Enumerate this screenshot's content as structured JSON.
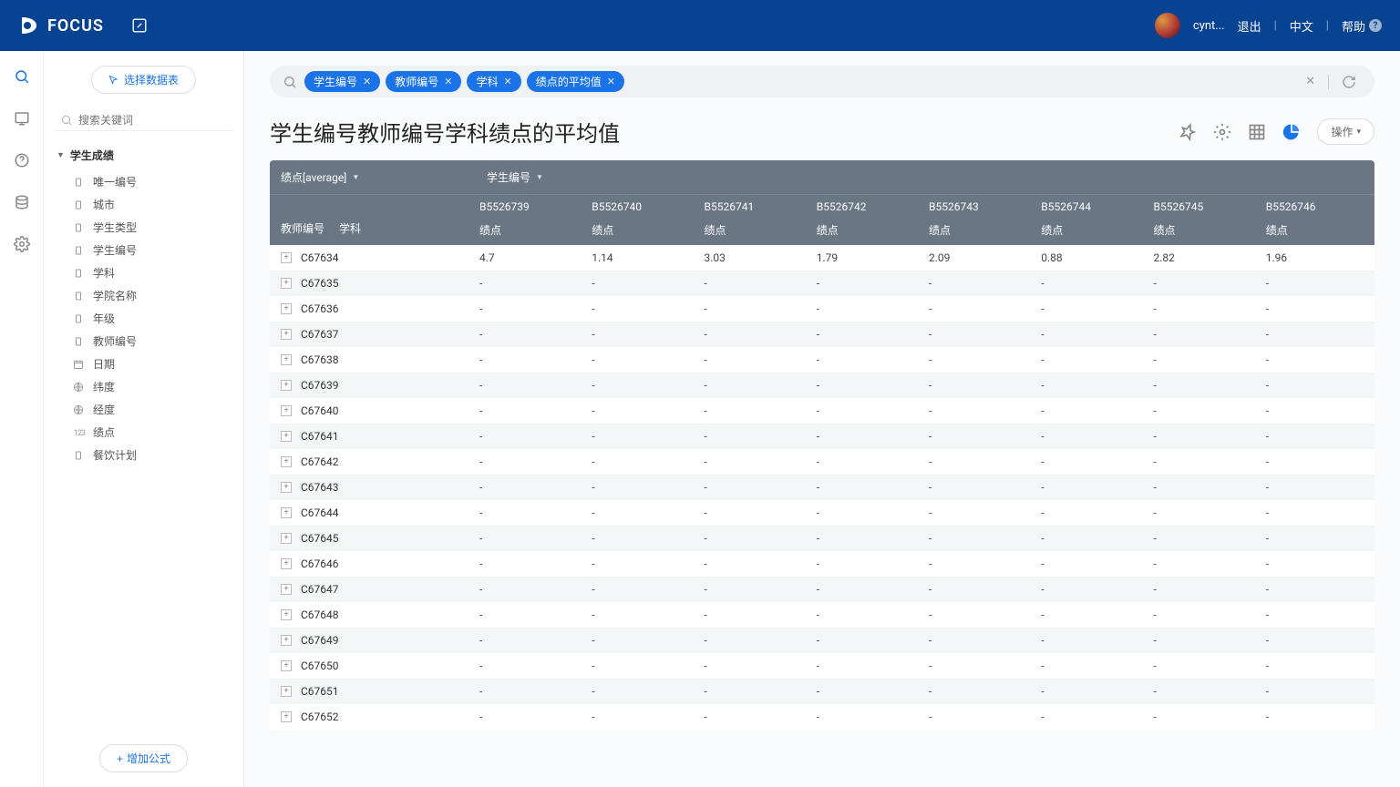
{
  "header": {
    "app_name": "FOCUS",
    "user_name": "cynt...",
    "logout": "退出",
    "lang": "中文",
    "help": "帮助"
  },
  "sidebar": {
    "select_table": "选择数据表",
    "search_placeholder": "搜索关键词",
    "tree_label": "学生成绩",
    "items": [
      {
        "icon": "T",
        "label": "唯一编号"
      },
      {
        "icon": "T",
        "label": "城市"
      },
      {
        "icon": "T",
        "label": "学生类型"
      },
      {
        "icon": "T",
        "label": "学生编号"
      },
      {
        "icon": "T",
        "label": "学科"
      },
      {
        "icon": "T",
        "label": "学院名称"
      },
      {
        "icon": "T",
        "label": "年级"
      },
      {
        "icon": "T",
        "label": "教师编号"
      },
      {
        "icon": "cal",
        "label": "日期"
      },
      {
        "icon": "geo",
        "label": "纬度"
      },
      {
        "icon": "geo",
        "label": "经度"
      },
      {
        "icon": "123",
        "label": "绩点"
      },
      {
        "icon": "T",
        "label": "餐饮计划"
      }
    ],
    "add_formula": "增加公式"
  },
  "query": {
    "chips": [
      "学生编号",
      "教师编号",
      "学科",
      "绩点的平均值"
    ]
  },
  "content": {
    "title": "学生编号教师编号学科绩点的平均值",
    "op_label": "操作",
    "thead_metric": "绩点[average]",
    "thead_dim": "学生编号",
    "row_label_a": "教师编号",
    "row_label_b": "学科",
    "sub_metric": "绩点",
    "columns": [
      "B5526739",
      "B5526740",
      "B5526741",
      "B5526742",
      "B5526743",
      "B5526744",
      "B5526745",
      "B5526746"
    ],
    "rows": [
      {
        "id": "C67634",
        "vals": [
          "4.7",
          "1.14",
          "3.03",
          "1.79",
          "2.09",
          "0.88",
          "2.82",
          "1.96"
        ]
      },
      {
        "id": "C67635",
        "vals": [
          "-",
          "-",
          "-",
          "-",
          "-",
          "-",
          "-",
          "-"
        ]
      },
      {
        "id": "C67636",
        "vals": [
          "-",
          "-",
          "-",
          "-",
          "-",
          "-",
          "-",
          "-"
        ]
      },
      {
        "id": "C67637",
        "vals": [
          "-",
          "-",
          "-",
          "-",
          "-",
          "-",
          "-",
          "-"
        ]
      },
      {
        "id": "C67638",
        "vals": [
          "-",
          "-",
          "-",
          "-",
          "-",
          "-",
          "-",
          "-"
        ]
      },
      {
        "id": "C67639",
        "vals": [
          "-",
          "-",
          "-",
          "-",
          "-",
          "-",
          "-",
          "-"
        ]
      },
      {
        "id": "C67640",
        "vals": [
          "-",
          "-",
          "-",
          "-",
          "-",
          "-",
          "-",
          "-"
        ]
      },
      {
        "id": "C67641",
        "vals": [
          "-",
          "-",
          "-",
          "-",
          "-",
          "-",
          "-",
          "-"
        ]
      },
      {
        "id": "C67642",
        "vals": [
          "-",
          "-",
          "-",
          "-",
          "-",
          "-",
          "-",
          "-"
        ]
      },
      {
        "id": "C67643",
        "vals": [
          "-",
          "-",
          "-",
          "-",
          "-",
          "-",
          "-",
          "-"
        ]
      },
      {
        "id": "C67644",
        "vals": [
          "-",
          "-",
          "-",
          "-",
          "-",
          "-",
          "-",
          "-"
        ]
      },
      {
        "id": "C67645",
        "vals": [
          "-",
          "-",
          "-",
          "-",
          "-",
          "-",
          "-",
          "-"
        ]
      },
      {
        "id": "C67646",
        "vals": [
          "-",
          "-",
          "-",
          "-",
          "-",
          "-",
          "-",
          "-"
        ]
      },
      {
        "id": "C67647",
        "vals": [
          "-",
          "-",
          "-",
          "-",
          "-",
          "-",
          "-",
          "-"
        ]
      },
      {
        "id": "C67648",
        "vals": [
          "-",
          "-",
          "-",
          "-",
          "-",
          "-",
          "-",
          "-"
        ]
      },
      {
        "id": "C67649",
        "vals": [
          "-",
          "-",
          "-",
          "-",
          "-",
          "-",
          "-",
          "-"
        ]
      },
      {
        "id": "C67650",
        "vals": [
          "-",
          "-",
          "-",
          "-",
          "-",
          "-",
          "-",
          "-"
        ]
      },
      {
        "id": "C67651",
        "vals": [
          "-",
          "-",
          "-",
          "-",
          "-",
          "-",
          "-",
          "-"
        ]
      },
      {
        "id": "C67652",
        "vals": [
          "-",
          "-",
          "-",
          "-",
          "-",
          "-",
          "-",
          "-"
        ]
      }
    ]
  }
}
